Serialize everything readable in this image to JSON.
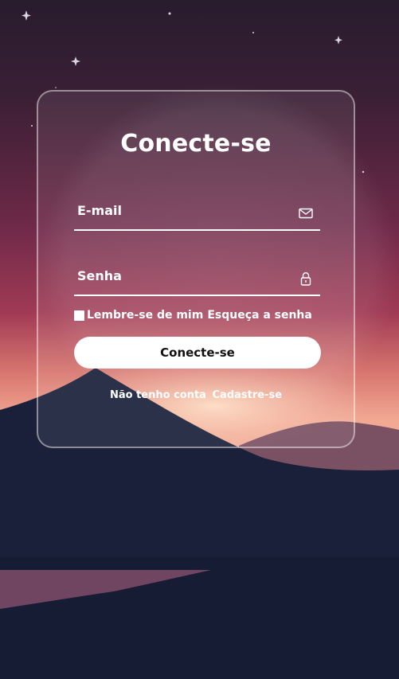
{
  "login": {
    "title": "Conecte-se",
    "email_placeholder": "E-mail",
    "password_placeholder": "Senha",
    "remember_label": "Lembre-se de mim",
    "forgot_link": "Esqueça a senha",
    "submit_label": "Conecte-se",
    "no_account_text": "Não tenho conta",
    "register_link": "Cadastre-se"
  },
  "icons": {
    "email": "mail-icon",
    "password": "lock-icon"
  },
  "colors": {
    "text": "#ffffff",
    "button_bg": "#ffffff",
    "button_text": "#111111",
    "sky_top": "#2a1d2e",
    "sky_mid": "#8a2d4e",
    "horizon": "#f0a493",
    "dunes": "#161c33"
  }
}
